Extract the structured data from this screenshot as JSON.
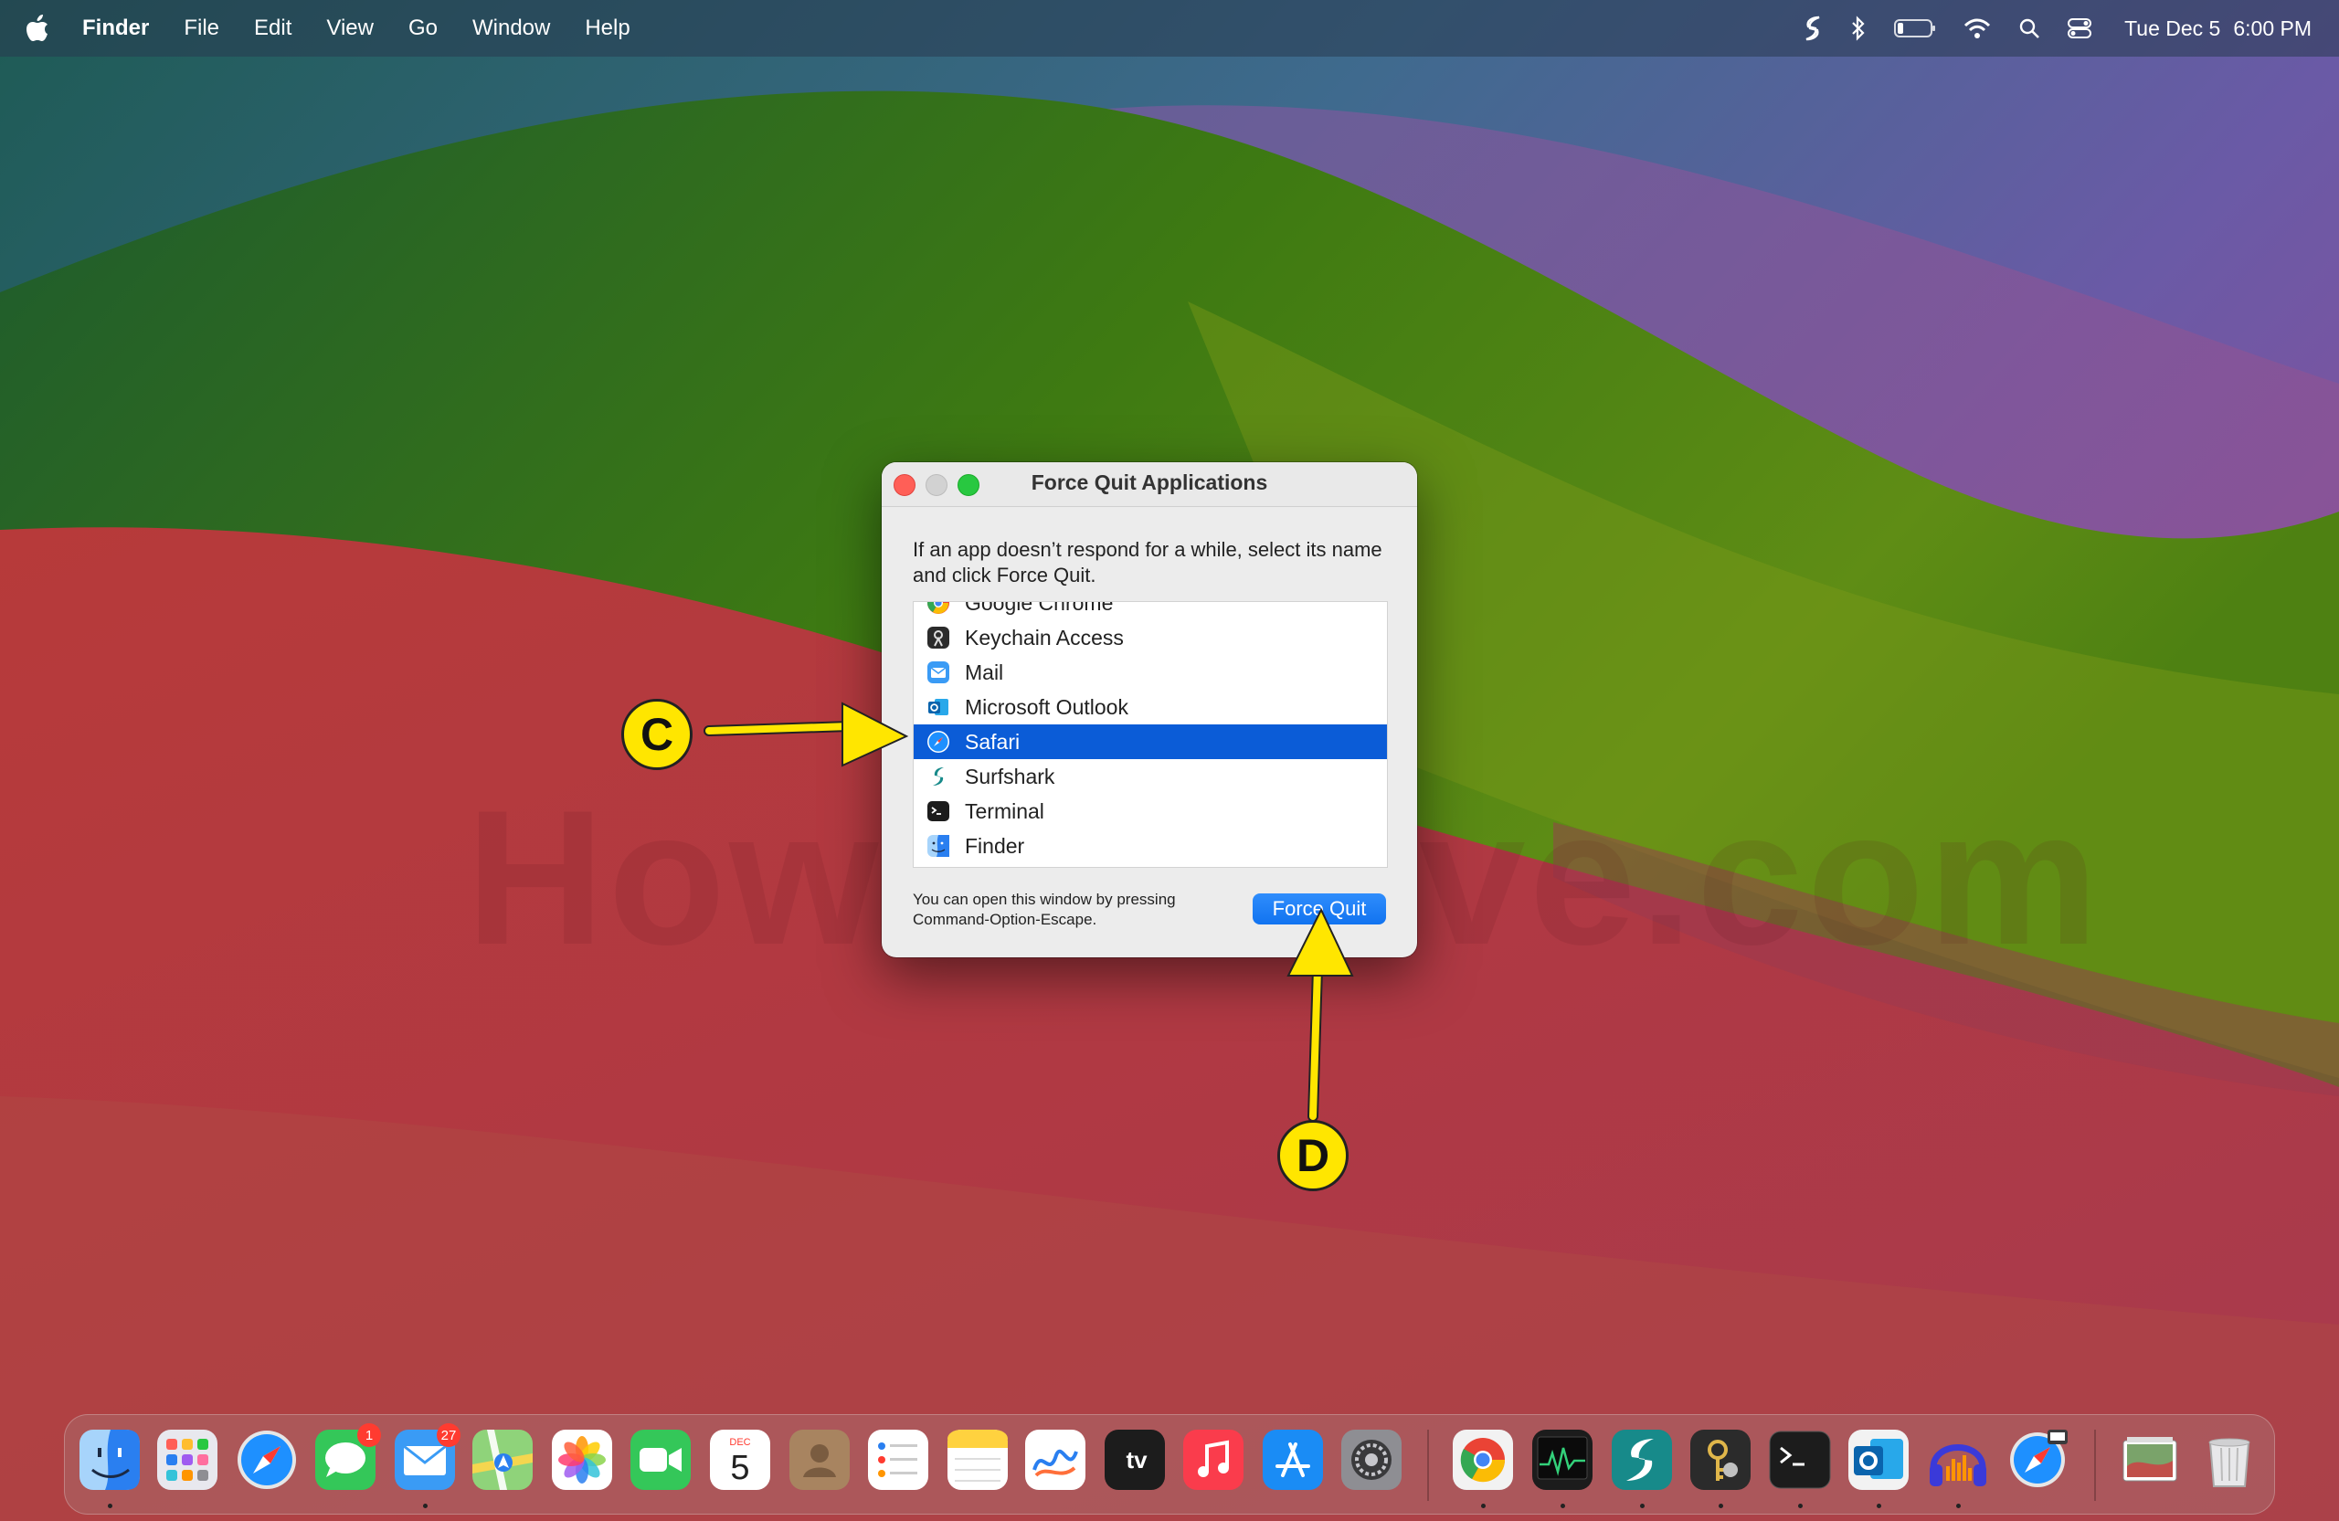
{
  "menubar": {
    "app_name": "Finder",
    "menus": [
      "File",
      "Edit",
      "View",
      "Go",
      "Window",
      "Help"
    ],
    "clock_date": "Tue Dec 5",
    "clock_time": "6:00 PM",
    "status_icons": [
      "surfshark-icon",
      "bluetooth-icon",
      "battery-icon",
      "wifi-icon",
      "spotlight-search-icon",
      "control-center-icon"
    ]
  },
  "watermark": "HowToSolve.com",
  "dialog": {
    "title": "Force Quit Applications",
    "instruction": "If an app doesn’t respond for a while, select its name and click Force Quit.",
    "apps": [
      {
        "name": "Google Chrome",
        "icon": "chrome-icon"
      },
      {
        "name": "Keychain Access",
        "icon": "keychain-icon"
      },
      {
        "name": "Mail",
        "icon": "mail-icon"
      },
      {
        "name": "Microsoft Outlook",
        "icon": "outlook-icon"
      },
      {
        "name": "Safari",
        "icon": "safari-icon",
        "selected": true
      },
      {
        "name": "Surfshark",
        "icon": "surfshark-icon"
      },
      {
        "name": "Terminal",
        "icon": "terminal-icon"
      },
      {
        "name": "Finder",
        "icon": "finder-icon"
      }
    ],
    "footnote": "You can open this window by pressing Command-Option-Escape.",
    "button_label": "Force Quit"
  },
  "annotations": {
    "callout_c": "C",
    "callout_d": "D",
    "color": "#ffe600"
  },
  "dock": {
    "calendar_month": "DEC",
    "calendar_day": "5",
    "tv_label": "tv",
    "messages_badge": "1",
    "mail_badge": "27",
    "apps": [
      "finder-icon",
      "launchpad-icon",
      "safari-icon",
      "messages-icon",
      "mail-icon",
      "maps-icon",
      "photos-icon",
      "facetime-icon",
      "calendar-icon",
      "contacts-icon",
      "reminders-icon",
      "notes-icon",
      "freeform-icon",
      "apple-tv-icon",
      "music-icon",
      "app-store-icon",
      "system-settings-icon",
      "chrome-icon",
      "activity-monitor-icon",
      "surfshark-icon",
      "keychain-icon",
      "terminal-icon",
      "outlook-icon",
      "audio-app-icon",
      "safari-icon",
      "downloads-stack-icon",
      "trash-icon"
    ]
  },
  "colors": {
    "selection": "#0b5cd7",
    "accent_button": "#1a7bf5"
  }
}
